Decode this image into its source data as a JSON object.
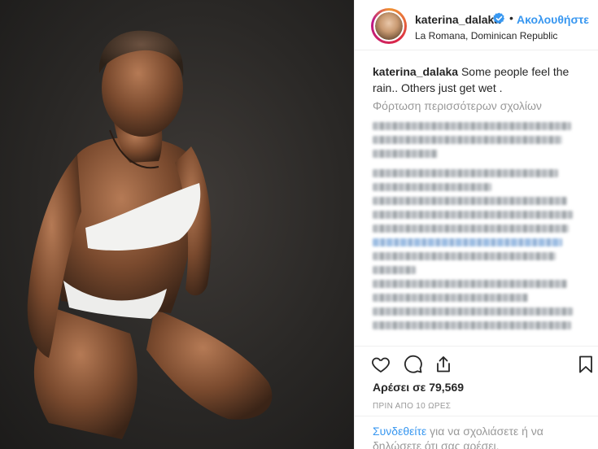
{
  "post": {
    "username": "katerina_dalaka",
    "follow_separator": "•",
    "follow_label": "Ακολουθήστε",
    "location": "La Romana, Dominican Republic",
    "caption_username": "katerina_dalaka",
    "caption_text": "Some people feel the rain.. Others just get wet .",
    "load_more": "Φόρτωση περισσότερων σχολίων",
    "likes": "Αρέσει σε 79,569",
    "timestamp": "ΠΡΙΝ ΑΠΟ 10 ΩΡΕΣ",
    "login_link": "Συνδεθείτε",
    "login_text": " για να σχολιάσετε ή να δηλώσετε ότι σας αρέσει."
  },
  "icons": {
    "verified": "verified-badge-icon",
    "like": "heart-icon",
    "comment": "comment-bubble-icon",
    "share": "share-icon",
    "save": "bookmark-icon"
  },
  "colors": {
    "accent": "#3897f0",
    "text": "#262626",
    "muted": "#999999",
    "border": "#efefef"
  }
}
